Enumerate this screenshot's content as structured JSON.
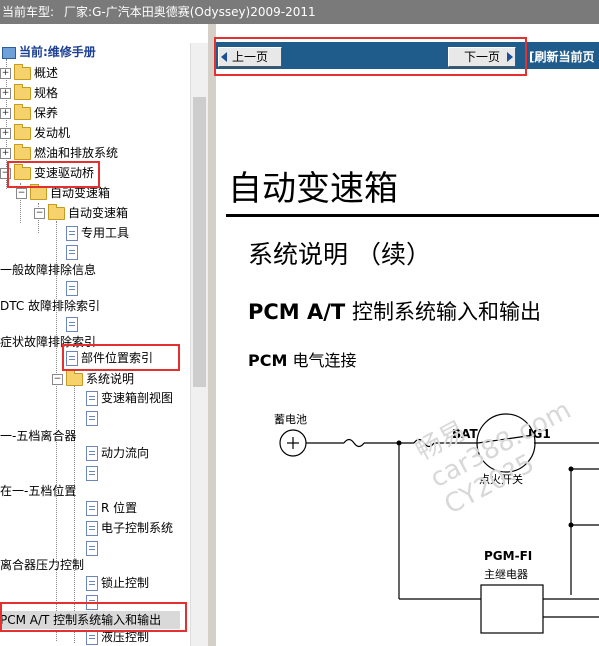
{
  "header": {
    "car_label": "当前车型:",
    "car_value": "厂家:G-广汽本田奥德赛(Odyssey)2009-2011"
  },
  "sidebar": {
    "root": "当前:维修手册",
    "items": [
      {
        "label": "概述"
      },
      {
        "label": "规格"
      },
      {
        "label": "保养"
      },
      {
        "label": "发动机"
      },
      {
        "label": "燃油和排放系统"
      },
      {
        "label": "变速驱动桥"
      },
      {
        "label": "自动变速箱"
      },
      {
        "label": "自动变速箱"
      },
      {
        "label": "专用工具"
      },
      {
        "label": "一般故障排除信息"
      },
      {
        "label": "DTC 故障排除索引"
      },
      {
        "label": "症状故障排除索引"
      },
      {
        "label": "部件位置索引"
      },
      {
        "label": "系统说明"
      },
      {
        "label": "变速箱剖视图"
      },
      {
        "label": "一-五档离合器"
      },
      {
        "label": "动力流向"
      },
      {
        "label": "在一-五档位置"
      },
      {
        "label": "R 位置"
      },
      {
        "label": "电子控制系统"
      },
      {
        "label": "离合器压力控制"
      },
      {
        "label": "锁止控制"
      },
      {
        "label": "PCM A/T 控制系统输入和输出"
      },
      {
        "label": "液压控制"
      }
    ]
  },
  "nav": {
    "prev_label": "上一页",
    "next_label": "下一页",
    "refresh_label": "[刷新当前页"
  },
  "content": {
    "title": "自动变速箱",
    "subtitle": "系统说明 （续）",
    "heading_bold": "PCM A/T",
    "heading_rest": " 控制系统输入和输出",
    "sub_bold": "PCM",
    "sub_rest": " 电气连接",
    "diagram": {
      "battery": "蓄电池",
      "bat": "BAT",
      "ig1": "IG1",
      "ignition": "点火开关",
      "pgmfi": "PGM-FI",
      "relay": "主继电器"
    },
    "watermark": [
      "畅易",
      "car388.com",
      "CY20?5"
    ]
  }
}
